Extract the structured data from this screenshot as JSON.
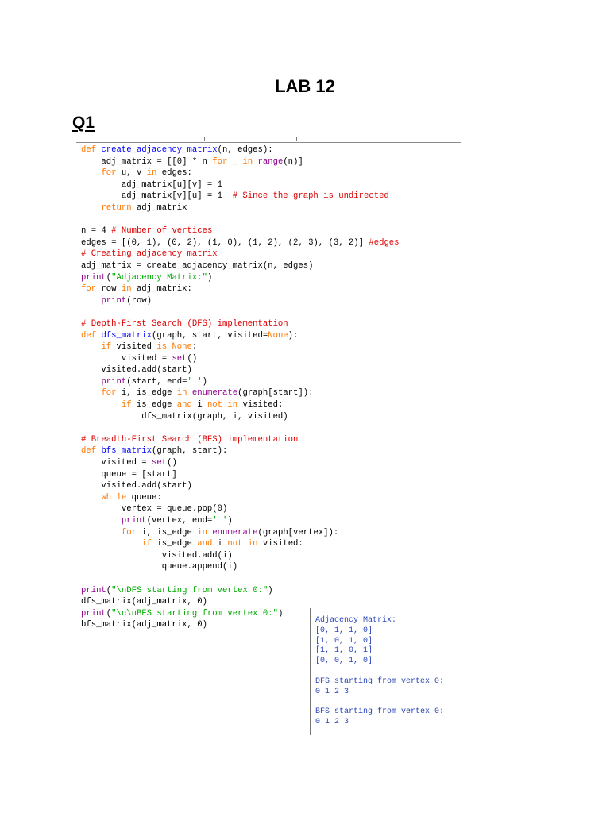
{
  "document": {
    "title": "LAB 12",
    "section": "Q1"
  },
  "colors": {
    "keyword": "#ff7700",
    "builtin": "#900090",
    "string": "#00aa00",
    "comment": "#dd0000",
    "defname": "#0000ff",
    "output_text": "#2a45b8"
  },
  "code": [
    [
      [
        "keyword",
        "def "
      ],
      [
        "defname",
        "create_adjacency_matrix"
      ],
      [
        "plain",
        "(n, edges):"
      ]
    ],
    [
      [
        "plain",
        "    adj_matrix = [[0] * n "
      ],
      [
        "keyword",
        "for"
      ],
      [
        "plain",
        " _ "
      ],
      [
        "keyword",
        "in"
      ],
      [
        "plain",
        " "
      ],
      [
        "builtin",
        "range"
      ],
      [
        "plain",
        "(n)]"
      ]
    ],
    [
      [
        "plain",
        "    "
      ],
      [
        "keyword",
        "for"
      ],
      [
        "plain",
        " u, v "
      ],
      [
        "keyword",
        "in"
      ],
      [
        "plain",
        " edges:"
      ]
    ],
    [
      [
        "plain",
        "        adj_matrix[u][v] = 1"
      ]
    ],
    [
      [
        "plain",
        "        adj_matrix[v][u] = 1  "
      ],
      [
        "comment",
        "# Since the graph is undirected"
      ]
    ],
    [
      [
        "plain",
        "    "
      ],
      [
        "keyword",
        "return"
      ],
      [
        "plain",
        " adj_matrix"
      ]
    ],
    [],
    [
      [
        "plain",
        "n = 4 "
      ],
      [
        "comment",
        "# Number of vertices"
      ]
    ],
    [
      [
        "plain",
        "edges = [(0, 1), (0, 2), (1, 0), (1, 2), (2, 3), (3, 2)] "
      ],
      [
        "comment",
        "#edges"
      ]
    ],
    [
      [
        "comment",
        "# Creating adjacency matrix"
      ]
    ],
    [
      [
        "plain",
        "adj_matrix = create_adjacency_matrix(n, edges)"
      ]
    ],
    [
      [
        "builtin",
        "print"
      ],
      [
        "plain",
        "("
      ],
      [
        "string",
        "\"Adjacency Matrix:\""
      ],
      [
        "plain",
        ")"
      ]
    ],
    [
      [
        "keyword",
        "for"
      ],
      [
        "plain",
        " row "
      ],
      [
        "keyword",
        "in"
      ],
      [
        "plain",
        " adj_matrix:"
      ]
    ],
    [
      [
        "plain",
        "    "
      ],
      [
        "builtin",
        "print"
      ],
      [
        "plain",
        "(row)"
      ]
    ],
    [],
    [
      [
        "comment",
        "# Depth-First Search (DFS) implementation"
      ]
    ],
    [
      [
        "keyword",
        "def "
      ],
      [
        "defname",
        "dfs_matrix"
      ],
      [
        "plain",
        "(graph, start, visited="
      ],
      [
        "keyword",
        "None"
      ],
      [
        "plain",
        "):"
      ]
    ],
    [
      [
        "plain",
        "    "
      ],
      [
        "keyword",
        "if"
      ],
      [
        "plain",
        " visited "
      ],
      [
        "keyword",
        "is"
      ],
      [
        "plain",
        " "
      ],
      [
        "keyword",
        "None"
      ],
      [
        "plain",
        ":"
      ]
    ],
    [
      [
        "plain",
        "        visited = "
      ],
      [
        "builtin",
        "set"
      ],
      [
        "plain",
        "()"
      ]
    ],
    [
      [
        "plain",
        "    visited.add(start)"
      ]
    ],
    [
      [
        "plain",
        "    "
      ],
      [
        "builtin",
        "print"
      ],
      [
        "plain",
        "(start, end="
      ],
      [
        "string",
        "' '"
      ],
      [
        "plain",
        ")"
      ]
    ],
    [
      [
        "plain",
        "    "
      ],
      [
        "keyword",
        "for"
      ],
      [
        "plain",
        " i, is_edge "
      ],
      [
        "keyword",
        "in"
      ],
      [
        "plain",
        " "
      ],
      [
        "builtin",
        "enumerate"
      ],
      [
        "plain",
        "(graph[start]):"
      ]
    ],
    [
      [
        "plain",
        "        "
      ],
      [
        "keyword",
        "if"
      ],
      [
        "plain",
        " is_edge "
      ],
      [
        "keyword",
        "and"
      ],
      [
        "plain",
        " i "
      ],
      [
        "keyword",
        "not in"
      ],
      [
        "plain",
        " visited:"
      ]
    ],
    [
      [
        "plain",
        "            dfs_matrix(graph, i, visited)"
      ]
    ],
    [],
    [
      [
        "comment",
        "# Breadth-First Search (BFS) implementation"
      ]
    ],
    [
      [
        "keyword",
        "def "
      ],
      [
        "defname",
        "bfs_matrix"
      ],
      [
        "plain",
        "(graph, start):"
      ]
    ],
    [
      [
        "plain",
        "    visited = "
      ],
      [
        "builtin",
        "set"
      ],
      [
        "plain",
        "()"
      ]
    ],
    [
      [
        "plain",
        "    queue = [start]"
      ]
    ],
    [
      [
        "plain",
        "    visited.add(start)"
      ]
    ],
    [
      [
        "plain",
        "    "
      ],
      [
        "keyword",
        "while"
      ],
      [
        "plain",
        " queue:"
      ]
    ],
    [
      [
        "plain",
        "        vertex = queue.pop(0)"
      ]
    ],
    [
      [
        "plain",
        "        "
      ],
      [
        "builtin",
        "print"
      ],
      [
        "plain",
        "(vertex, end="
      ],
      [
        "string",
        "' '"
      ],
      [
        "plain",
        ")"
      ]
    ],
    [
      [
        "plain",
        "        "
      ],
      [
        "keyword",
        "for"
      ],
      [
        "plain",
        " i, is_edge "
      ],
      [
        "keyword",
        "in"
      ],
      [
        "plain",
        " "
      ],
      [
        "builtin",
        "enumerate"
      ],
      [
        "plain",
        "(graph[vertex]):"
      ]
    ],
    [
      [
        "plain",
        "            "
      ],
      [
        "keyword",
        "if"
      ],
      [
        "plain",
        " is_edge "
      ],
      [
        "keyword",
        "and"
      ],
      [
        "plain",
        " i "
      ],
      [
        "keyword",
        "not in"
      ],
      [
        "plain",
        " visited:"
      ]
    ],
    [
      [
        "plain",
        "                visited.add(i)"
      ]
    ],
    [
      [
        "plain",
        "                queue.append(i)"
      ]
    ],
    [],
    [
      [
        "builtin",
        "print"
      ],
      [
        "plain",
        "("
      ],
      [
        "string",
        "\"\\nDFS starting from vertex 0:\""
      ],
      [
        "plain",
        ")"
      ]
    ],
    [
      [
        "plain",
        "dfs_matrix(adj_matrix, 0)"
      ]
    ],
    [
      [
        "builtin",
        "print"
      ],
      [
        "plain",
        "("
      ],
      [
        "string",
        "\"\\n\\nBFS starting from vertex 0:\""
      ],
      [
        "plain",
        ")"
      ]
    ],
    [
      [
        "plain",
        "bfs_matrix(adj_matrix, 0)"
      ]
    ]
  ],
  "output": [
    "Adjacency Matrix:",
    "[0, 1, 1, 0]",
    "[1, 0, 1, 0]",
    "[1, 1, 0, 1]",
    "[0, 0, 1, 0]",
    "",
    "DFS starting from vertex 0:",
    "0 1 2 3",
    "",
    "BFS starting from vertex 0:",
    "0 1 2 3"
  ]
}
